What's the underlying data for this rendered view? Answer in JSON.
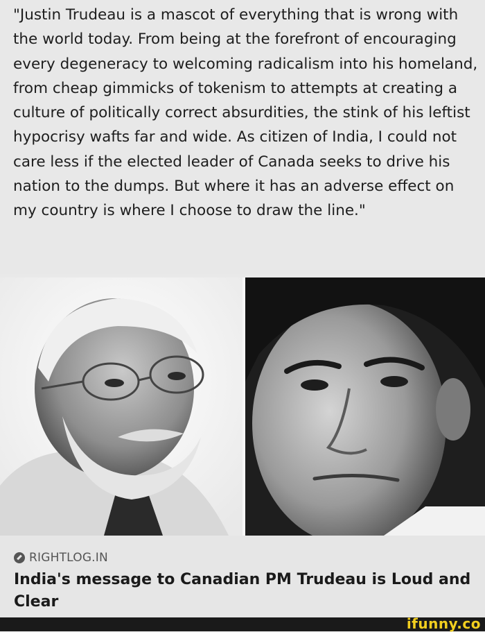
{
  "post": {
    "quote": "\"Justin Trudeau is a mascot of everything that is wrong with the world today. From being at the forefront of encouraging every degeneracy to welcoming radicalism into his homeland, from cheap gimmicks of tokenism to attempts at creating a culture of politically correct absurdities, the stink of his leftist hypocrisy wafts far and wide. As citizen of India, I could not care less if the elected leader of Canada seeks to drive his nation to the dumps. But where it has an adverse effect on my country is where I choose to draw the line.\""
  },
  "link_card": {
    "source": "RIGHTLOG.IN",
    "source_icon": "compass-icon",
    "title": "India's message to Canadian PM Trudeau is Loud and Clear"
  },
  "watermark": {
    "text": "ifunny.co"
  }
}
